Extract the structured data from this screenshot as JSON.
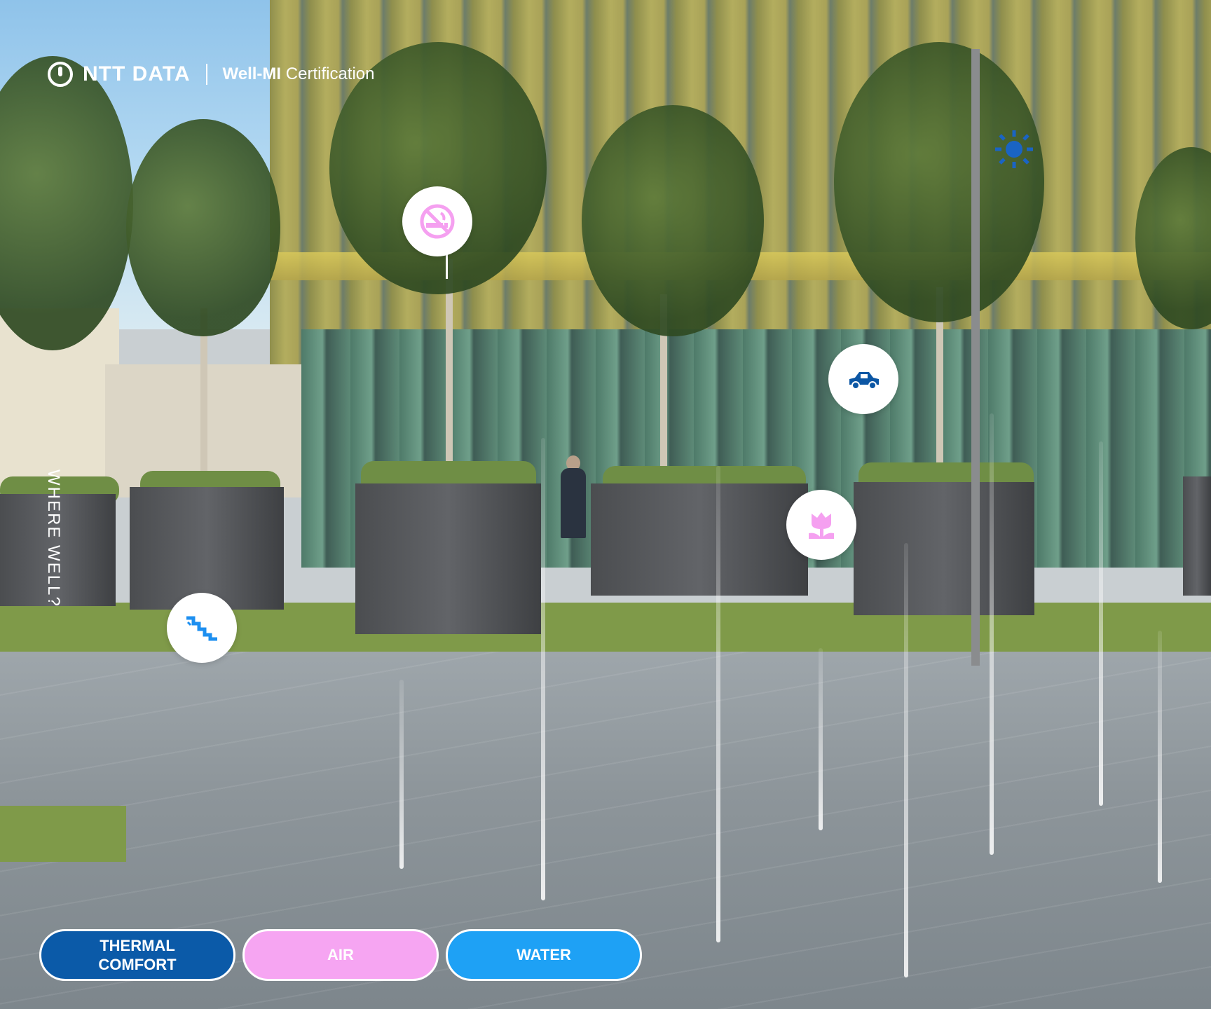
{
  "header": {
    "brand": "NTT DATA",
    "product_bold": "Well-MI",
    "product_rest": "Certification"
  },
  "side_title": "WHERE WELL?",
  "markers": [
    {
      "name": "no-smoking",
      "icon": "no-smoking-icon",
      "color": "#f5a0f0"
    },
    {
      "name": "car",
      "icon": "car-icon",
      "color": "#0b56a4"
    },
    {
      "name": "flower",
      "icon": "flower-icon",
      "color": "#f5a0f0"
    },
    {
      "name": "stairs",
      "icon": "stairs-icon",
      "color": "#1d8ff0"
    }
  ],
  "sun_icon": {
    "icon": "sun-icon",
    "color": "#1a64c4"
  },
  "categories": [
    {
      "label": "THERMAL COMFORT",
      "color": "#0b5aa8"
    },
    {
      "label": "AIR",
      "color": "#f6a5f2"
    },
    {
      "label": "WATER",
      "color": "#1ea1f5"
    }
  ]
}
